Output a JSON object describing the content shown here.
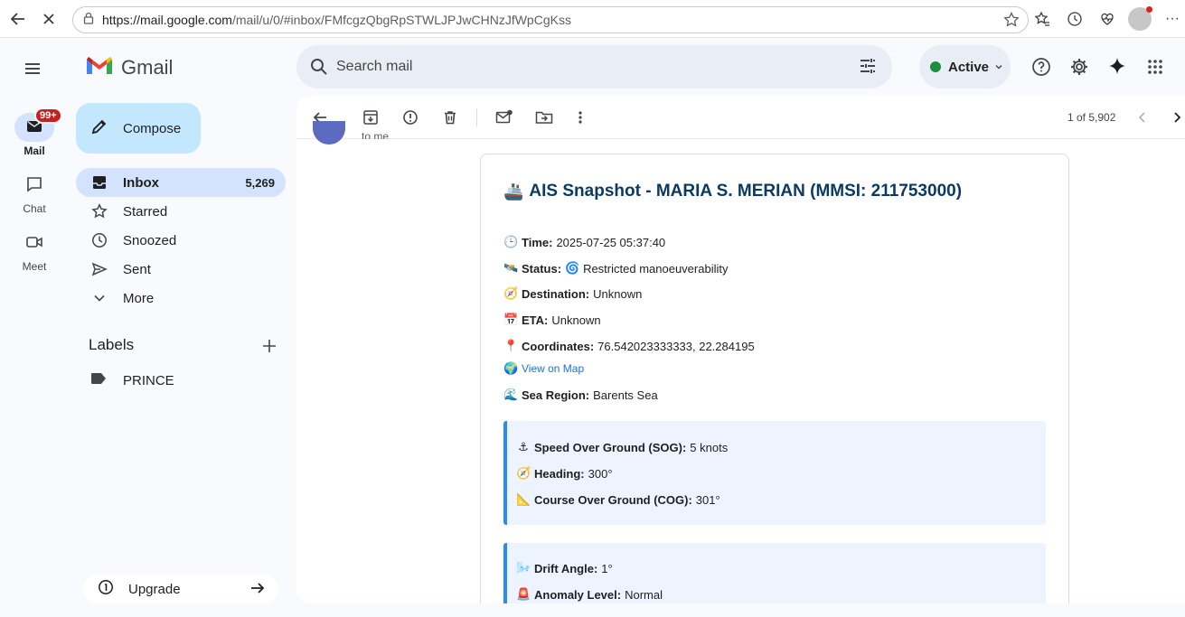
{
  "browser": {
    "url_host": "https://mail.google.com",
    "url_path": "/mail/u/0/#inbox/FMfcgzQbgRpSTWLJPJwCHNzJfWpCgKss"
  },
  "rail": {
    "mail_label": "Mail",
    "mail_badge": "99+",
    "chat_label": "Chat",
    "meet_label": "Meet"
  },
  "app": {
    "name": "Gmail"
  },
  "search": {
    "placeholder": "Search mail"
  },
  "status": {
    "label": "Active",
    "color": "#1e8e3e"
  },
  "compose": {
    "label": "Compose"
  },
  "nav": {
    "items": [
      {
        "label": "Inbox",
        "count": "5,269"
      },
      {
        "label": "Starred"
      },
      {
        "label": "Snoozed"
      },
      {
        "label": "Sent"
      },
      {
        "label": "More"
      }
    ]
  },
  "labels": {
    "heading": "Labels",
    "items": [
      {
        "label": "PRINCE"
      }
    ]
  },
  "upgrade": {
    "label": "Upgrade"
  },
  "toolbar": {
    "pager": "1 of 5,902"
  },
  "message": {
    "to_me": "to me",
    "title": "AIS Snapshot - MARIA S. MERIAN (MMSI: 211753000)",
    "time_label": "Time:",
    "time_value": "2025-07-25 05:37:40",
    "status_label": "Status:",
    "status_value": "Restricted manoeuverability",
    "destination_label": "Destination:",
    "destination_value": "Unknown",
    "eta_label": "ETA:",
    "eta_value": "Unknown",
    "coords_label": "Coordinates:",
    "coords_value": "76.542023333333, 22.284195",
    "map_link": "View on Map",
    "region_label": "Sea Region:",
    "region_value": "Barents Sea",
    "sog_label": "Speed Over Ground (SOG):",
    "sog_value": "5 knots",
    "heading_label": "Heading:",
    "heading_value": "300°",
    "cog_label": "Course Over Ground (COG):",
    "cog_value": "301°",
    "drift_label": "Drift Angle:",
    "drift_value": "1°",
    "anomaly_label": "Anomaly Level:",
    "anomaly_value": "Normal"
  }
}
